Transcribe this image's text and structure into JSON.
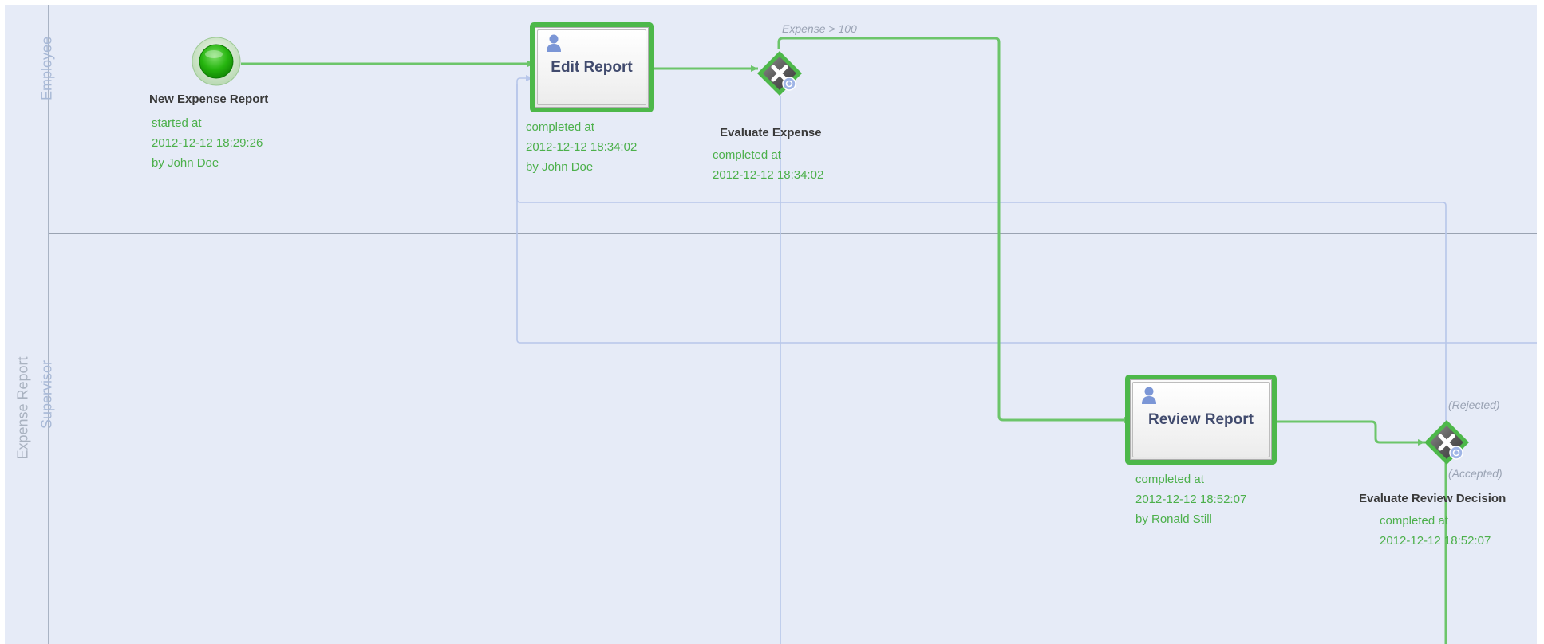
{
  "pool": {
    "label": "Expense Report"
  },
  "lanes": [
    {
      "label": "Employee"
    },
    {
      "label": "Supervisor"
    }
  ],
  "start_event": {
    "title": "New Expense Report",
    "info": [
      "started at",
      "2012-12-12 18:29:26",
      "by John Doe"
    ]
  },
  "tasks": {
    "edit": {
      "label": "Edit Report",
      "info": [
        "completed at",
        "2012-12-12 18:34:02",
        "by John Doe"
      ]
    },
    "review": {
      "label": "Review Report",
      "info": [
        "completed at",
        "2012-12-12 18:52:07",
        "by Ronald Still"
      ]
    }
  },
  "gateways": {
    "evaluate_expense": {
      "title": "Evaluate Expense",
      "info": [
        "completed at",
        "2012-12-12 18:34:02"
      ]
    },
    "evaluate_review": {
      "title": "Evaluate Review Decision",
      "info": [
        "completed at",
        "2012-12-12 18:52:07"
      ]
    }
  },
  "conditions": {
    "expense_gt": "Expense > 100",
    "rejected": "(Rejected)",
    "accepted": "(Accepted)"
  },
  "colors": {
    "completed_flow": "#6cc56a",
    "pending_flow": "#b7c6ea",
    "task_border": "#4db84a",
    "lane_background": "#e6ebf7"
  }
}
